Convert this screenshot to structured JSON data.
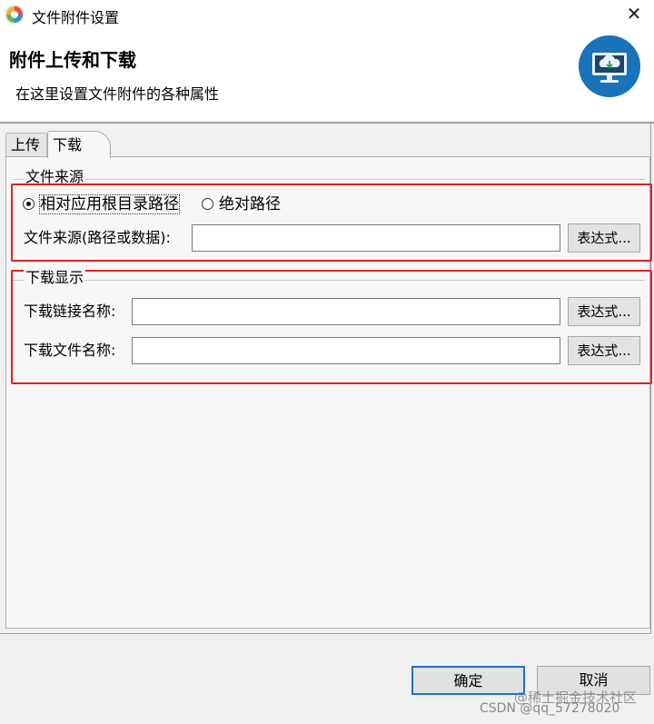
{
  "window": {
    "title": "文件附件设置",
    "close_glyph": "✕"
  },
  "header": {
    "title": "附件上传和下载",
    "subtitle": "在这里设置文件附件的各种属性",
    "icon": "cloud-monitor-icon"
  },
  "tabs": [
    {
      "label": "上传",
      "active": false
    },
    {
      "label": "下载",
      "active": true
    }
  ],
  "file_source": {
    "group_label": "文件来源",
    "path_options": [
      {
        "label": "相对应用根目录路径",
        "selected": true
      },
      {
        "label": "绝对路径",
        "selected": false
      }
    ],
    "source_field": {
      "label": "文件来源(路径或数据):",
      "value": "",
      "button_label": "表达式..."
    }
  },
  "download_display": {
    "group_label": "下载显示",
    "link_name_field": {
      "label": "下载链接名称:",
      "value": "",
      "button_label": "表达式..."
    },
    "file_name_field": {
      "label": "下载文件名称:",
      "value": "",
      "button_label": "表达式..."
    }
  },
  "buttons": {
    "ok": "确定",
    "cancel": "取消"
  },
  "watermark": {
    "line1": "@稀土掘金技术社区",
    "line2": "CSDN @qq_57278020"
  },
  "colors": {
    "highlight_box": "#e0201f",
    "default_button_border": "#1a6fd6",
    "header_icon_bg": "#1a72b8"
  }
}
